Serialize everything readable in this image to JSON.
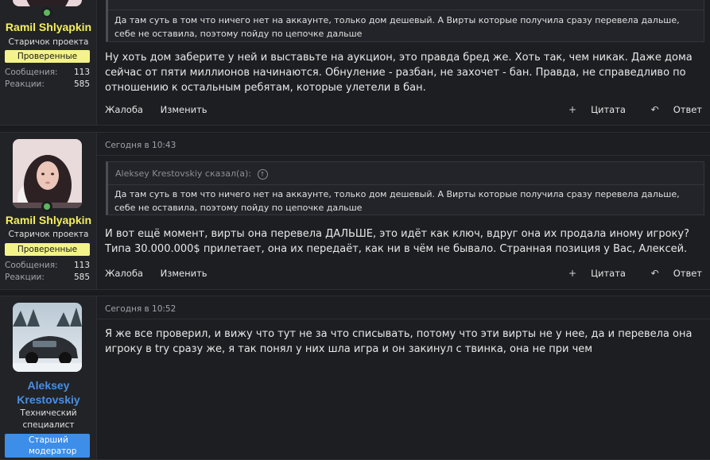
{
  "posts": [
    {
      "username": "Ramil Shlyapkin",
      "user_title": "Старичок проекта",
      "badge": "Проверенные",
      "stats": [
        {
          "label": "Сообщения:",
          "value": "113"
        },
        {
          "label": "Реакции:",
          "value": "585"
        }
      ],
      "date": "",
      "quote_author": "",
      "quote_text": "Да там суть в том что ничего нет на аккаунте, только дом дешевый. А Вирты которые получила сразу перевела дальше, себе не оставила, поэтому пойду по цепочке дальше",
      "message": "Ну хоть дом заберите у ней и выставьте на аукцион, это правда бред же. Хоть так, чем никак. Даже дома сейчас от пяти миллионов начинаются. Обнуление - разбан, не захочет - бан. Правда, не справедливо по отношению к остальным ребятам, которые улетели в бан.",
      "actions": {
        "report": "Жалоба",
        "edit": "Изменить",
        "quote": "Цитата",
        "reply": "Ответ"
      }
    },
    {
      "username": "Ramil Shlyapkin",
      "user_title": "Старичок проекта",
      "badge": "Проверенные",
      "stats": [
        {
          "label": "Сообщения:",
          "value": "113"
        },
        {
          "label": "Реакции:",
          "value": "585"
        }
      ],
      "date": "Сегодня в 10:43",
      "quote_author": "Aleksey Krestovskiy сказал(а):",
      "quote_text": "Да там суть в том что ничего нет на аккаунте, только дом дешевый. А Вирты которые получила сразу перевела дальше, себе не оставила, поэтому пойду по цепочке дальше",
      "message": "И вот ещё момент, вирты она перевела ДАЛЬШЕ, это идёт как ключ, вдруг она их продала иному игроку? Типа 30.000.000$ прилетает, она их передаёт, как ни в чём не бывало. Странная позиция у Вас, Алексей.",
      "actions": {
        "report": "Жалоба",
        "edit": "Изменить",
        "quote": "Цитата",
        "reply": "Ответ"
      }
    },
    {
      "username": "Aleksey Krestovskiy",
      "user_title": "Технический специалист",
      "badge": "Старший модератор",
      "date": "Сегодня в 10:52",
      "message": "Я же все проверил, и вижу что тут не за что списывать, потому что эти вирты не у нее, да и перевела она игроку в try сразу же, я так понял у них шла игра и он закинул с твинка, она не при чем"
    }
  ],
  "colors": {
    "username_yellow": "#f5f05a",
    "username_blue": "#4a8fe0",
    "badge_yellow": "#f3f38a",
    "badge_blue": "#3d8ee8",
    "online_green": "#5cb85c"
  }
}
